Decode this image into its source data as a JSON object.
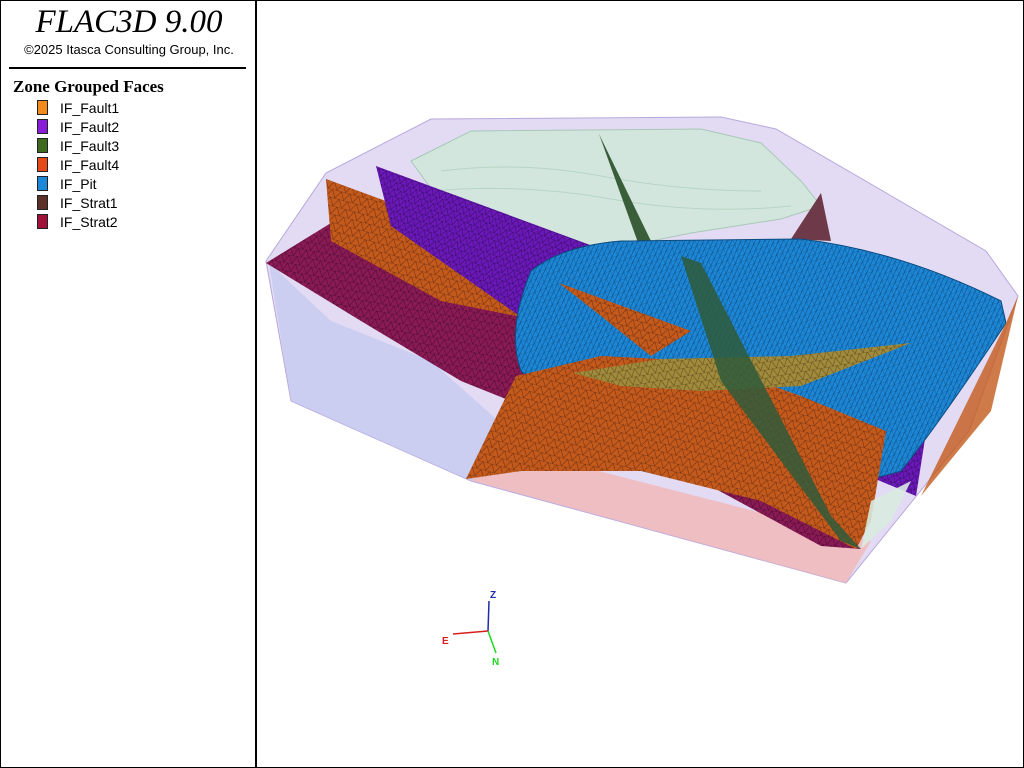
{
  "header": {
    "title": "FLAC3D 9.00",
    "copyright": "©2025 Itasca Consulting Group, Inc."
  },
  "legend": {
    "title": "Zone Grouped Faces",
    "items": [
      {
        "label": "IF_Fault1",
        "color": "#f28a1e"
      },
      {
        "label": "IF_Fault2",
        "color": "#8a1ed8"
      },
      {
        "label": "IF_Fault3",
        "color": "#3e6a20"
      },
      {
        "label": "IF_Fault4",
        "color": "#e34a18"
      },
      {
        "label": "IF_Pit",
        "color": "#1e88d8"
      },
      {
        "label": "IF_Strat1",
        "color": "#5c3228"
      },
      {
        "label": "IF_Strat2",
        "color": "#a0123a"
      }
    ]
  },
  "axes": {
    "z": {
      "label": "Z",
      "color": "#1f2aa8"
    },
    "e": {
      "label": "E",
      "color": "#d81e1e"
    },
    "n": {
      "label": "N",
      "color": "#1ed81e"
    }
  },
  "icons": [
    "axis-triad-icon"
  ]
}
